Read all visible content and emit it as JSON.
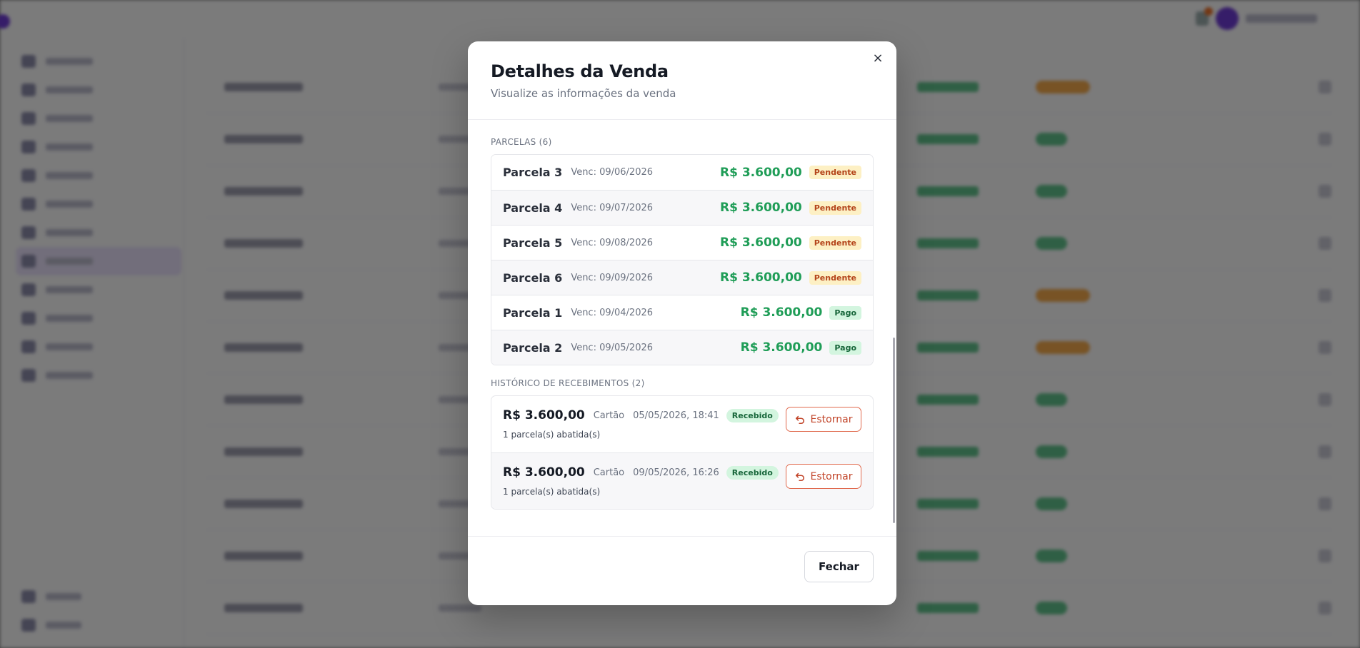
{
  "modal": {
    "title": "Detalhes da Venda",
    "subtitle": "Visualize as informações da venda",
    "close_icon": "×",
    "installments": {
      "label": "PARCELAS (6)",
      "items": [
        {
          "name": "Parcela 3",
          "due": "Venc: 09/06/2026",
          "amount": "R$ 3.600,00",
          "status": "Pendente"
        },
        {
          "name": "Parcela 4",
          "due": "Venc: 09/07/2026",
          "amount": "R$ 3.600,00",
          "status": "Pendente"
        },
        {
          "name": "Parcela 5",
          "due": "Venc: 09/08/2026",
          "amount": "R$ 3.600,00",
          "status": "Pendente"
        },
        {
          "name": "Parcela 6",
          "due": "Venc: 09/09/2026",
          "amount": "R$ 3.600,00",
          "status": "Pendente"
        },
        {
          "name": "Parcela 1",
          "due": "Venc: 09/04/2026",
          "amount": "R$ 3.600,00",
          "status": "Pago"
        },
        {
          "name": "Parcela 2",
          "due": "Venc: 09/05/2026",
          "amount": "R$ 3.600,00",
          "status": "Pago"
        }
      ]
    },
    "receipts": {
      "label": "HISTÓRICO DE RECEBIMENTOS (2)",
      "items": [
        {
          "amount": "R$ 3.600,00",
          "method": "Cartão",
          "date": "05/05/2026, 18:41",
          "status": "Recebido",
          "note": "1 parcela(s) abatida(s)",
          "action": "Estornar"
        },
        {
          "amount": "R$ 3.600,00",
          "method": "Cartão",
          "date": "09/05/2026, 16:26",
          "status": "Recebido",
          "note": "1 parcela(s) abatida(s)",
          "action": "Estornar"
        }
      ]
    },
    "footer": {
      "close_label": "Fechar"
    }
  },
  "colors": {
    "amount_green": "#1f9d57",
    "pending_bg": "#fdf0c4",
    "pending_text": "#b4441a",
    "paid_bg": "#d3f5df",
    "paid_text": "#17663a",
    "reverse_border": "#e06a4e",
    "brand_purple": "#6d3bd2"
  },
  "icons": {
    "close": "close-icon",
    "reverse": "undo-arrow-icon"
  }
}
